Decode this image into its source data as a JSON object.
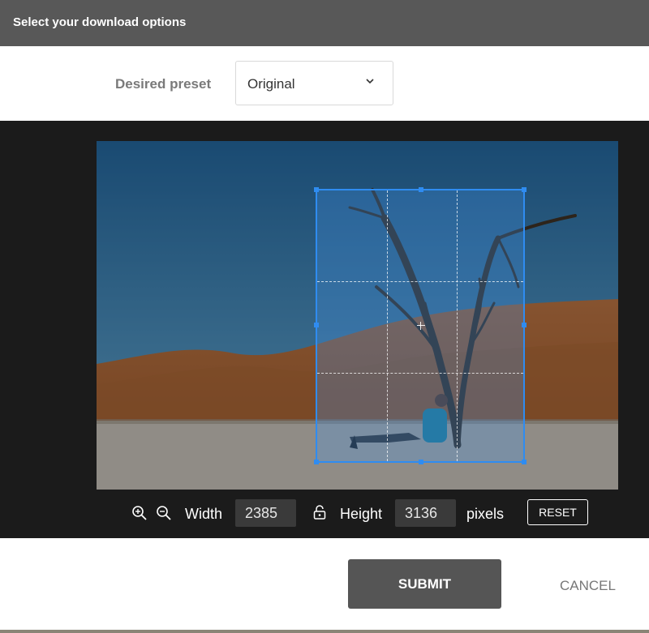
{
  "dialog": {
    "title": "Select your download options"
  },
  "preset": {
    "label": "Desired preset",
    "selected": "Original",
    "icon": "chevron-down-icon"
  },
  "controls": {
    "zoom_in_icon": "zoom-in-icon",
    "zoom_out_icon": "zoom-out-icon",
    "width_label": "Width",
    "width_value": "2385",
    "lock_icon": "lock-icon",
    "height_label": "Height",
    "height_value": "3136",
    "units_label": "pixels",
    "reset_label": "RESET"
  },
  "actions": {
    "submit_label": "SUBMIT",
    "cancel_label": "CANCEL"
  },
  "colors": {
    "accent": "#2f8cf1",
    "titlebar": "#585858",
    "editor_bg": "#1b1b1b",
    "submit_bg": "#555555"
  }
}
